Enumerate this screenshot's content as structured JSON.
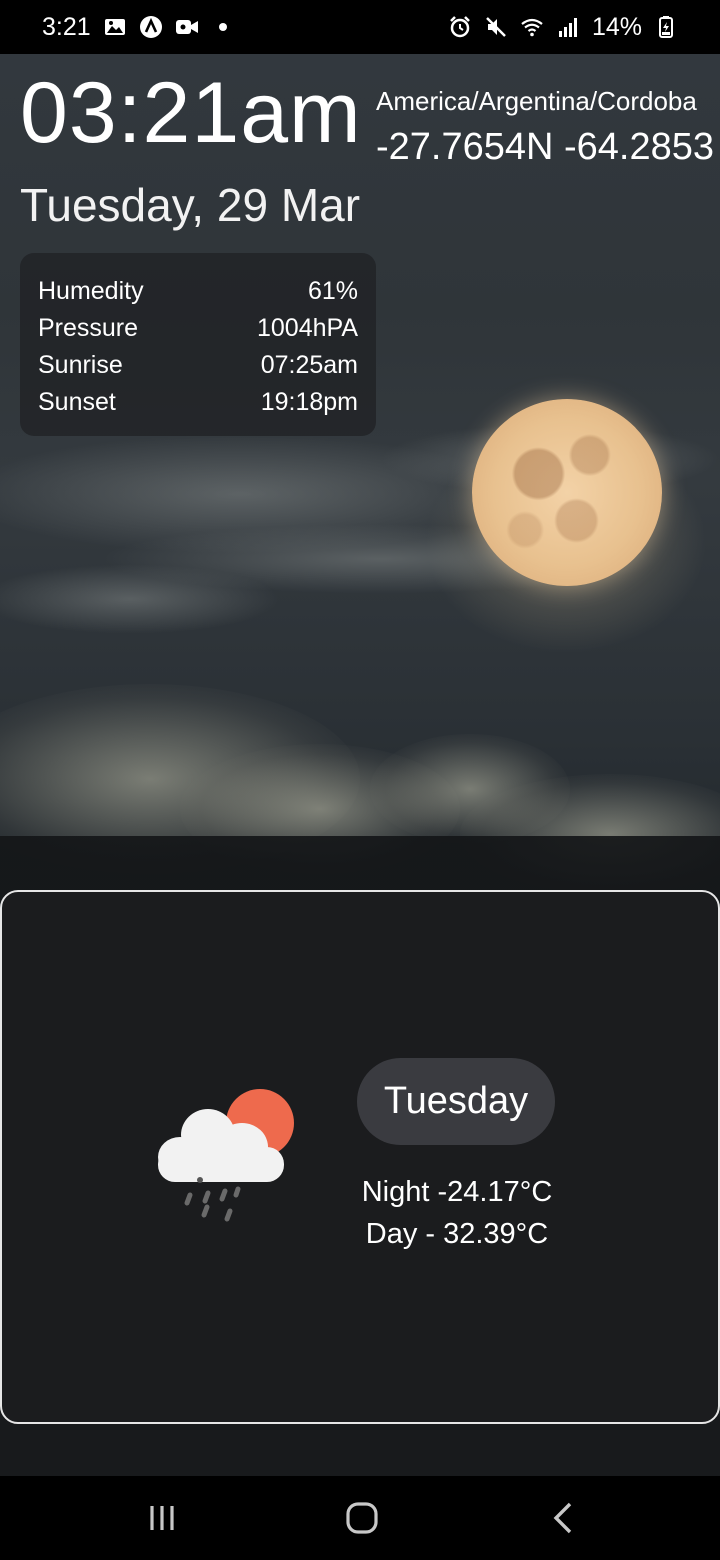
{
  "status_bar": {
    "time": "3:21",
    "battery": "14%"
  },
  "header": {
    "time": "03:21am",
    "timezone": "America/Argentina/Cordoba",
    "coordinates": "-27.7654N -64.2853",
    "date": "Tuesday, 29 Mar"
  },
  "info": {
    "rows": [
      {
        "label": "Humedity",
        "value": "61%"
      },
      {
        "label": "Pressure",
        "value": "1004hPA"
      },
      {
        "label": "Sunrise",
        "value": "07:25am"
      },
      {
        "label": "Sunset",
        "value": "19:18pm"
      }
    ]
  },
  "forecast": {
    "icon": "cloud-sun-rain-icon",
    "day": "Tuesday",
    "night": "Night -24.17°C",
    "day_temp": "Day - 32.39°C"
  },
  "colors": {
    "sun": "#ee6a4d",
    "cloud": "#f2f2f2",
    "pill": "#3a3b40",
    "card_border": "#e6e6e6"
  }
}
